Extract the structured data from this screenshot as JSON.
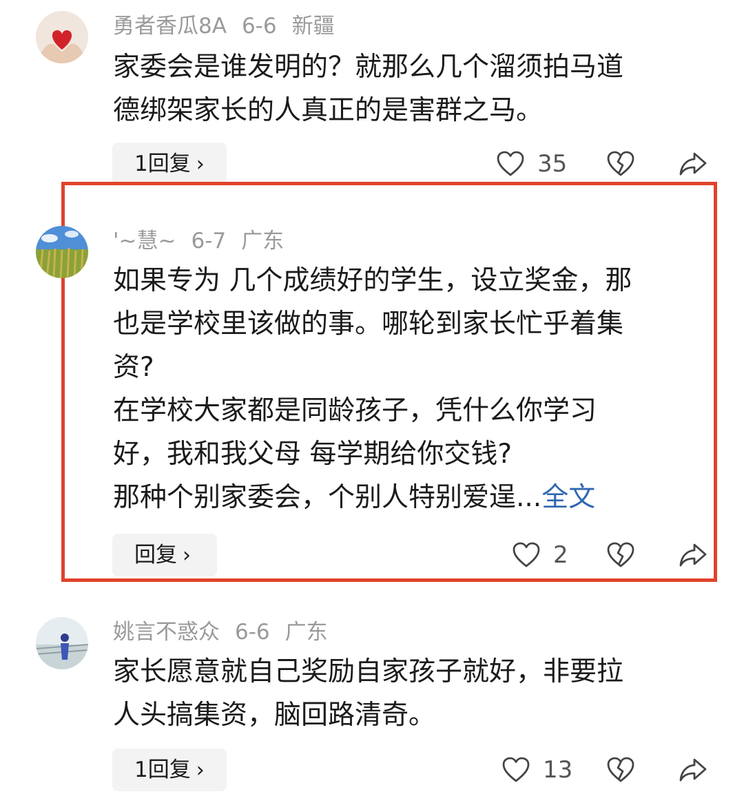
{
  "comments": [
    {
      "username": "勇者香瓜8A",
      "date": "6-6",
      "location": "新疆",
      "text": "家委会是谁发明的？就那么几个溜须拍马道\n德绑架家长的人真正的是害群之马。",
      "more": "",
      "reply_label": "1回复",
      "likes": "35",
      "avatar_icon": "heart-hands-avatar"
    },
    {
      "username": "'~慧~",
      "date": "6-7",
      "location": "广东",
      "text": "如果专为 几个成绩好的学生，设立奖金，那\n也是学校里该做的事。哪轮到家长忙乎着集\n资?\n在学校大家都是同龄孩子，凭什么你学习\n好，我和我父母 每学期给你交钱?\n那种个别家委会，个别人特别爱逞...",
      "more": "全文",
      "reply_label": "回复",
      "likes": "2",
      "avatar_icon": "wheat-field-avatar"
    },
    {
      "username": "姚言不惑众",
      "date": "6-6",
      "location": "广东",
      "text": "家长愿意就自己奖励自家孩子就好，非要拉\n人头搞集资，脑回路清奇。",
      "more": "",
      "reply_label": "1回复",
      "likes": "13",
      "avatar_icon": "person-outdoor-avatar"
    }
  ],
  "ui": {
    "chevron": "›",
    "highlight_color": "#e0432b",
    "link_color": "#2f66b3"
  }
}
